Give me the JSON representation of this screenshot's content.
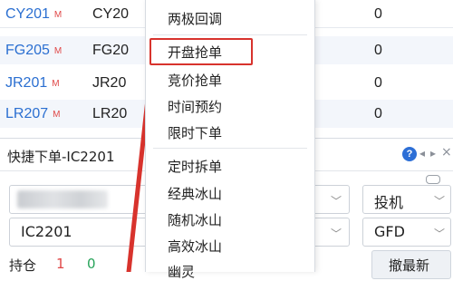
{
  "table": {
    "rows": [
      {
        "code": "CY201",
        "mark": "M",
        "name": "CY20",
        "value": "0"
      },
      {
        "code": "FG205",
        "mark": "M",
        "name": "FG20",
        "value": "0"
      },
      {
        "code": "JR201",
        "mark": "M",
        "name": "JR20",
        "value": "0"
      },
      {
        "code": "LR207",
        "mark": "M",
        "name": "LR20",
        "value": "0"
      }
    ]
  },
  "panel": {
    "title": "快捷下单-IC2201",
    "help": "?",
    "nav_prev": "◂",
    "nav_next": "▸",
    "close": "×",
    "instrument_value": "IC2201",
    "speculation_value": "投机",
    "tif_value": "GFD",
    "position_label": "持仓",
    "position_long": "1",
    "position_short": "0",
    "cancel_latest_label": "撤最新",
    "dropdown_arrow": "﹀"
  },
  "menu": {
    "items": [
      "两极回调",
      "开盘抢单",
      "竞价抢单",
      "时间预约",
      "限时下单",
      "定时拆单",
      "经典冰山",
      "随机冰山",
      "高效冰山",
      "幽灵"
    ],
    "highlighted": "开盘抢单"
  },
  "colors": {
    "code_blue": "#2b6fd1",
    "mark_red": "#e04848",
    "alt_row": "#f3f6fb",
    "annotation_red": "#d8332d",
    "long_red": "#e04848",
    "short_green": "#27a35a"
  },
  "icons": [
    "help-icon",
    "chevron-left-icon",
    "chevron-right-icon",
    "close-icon",
    "link-icon",
    "chevron-down-icon"
  ]
}
